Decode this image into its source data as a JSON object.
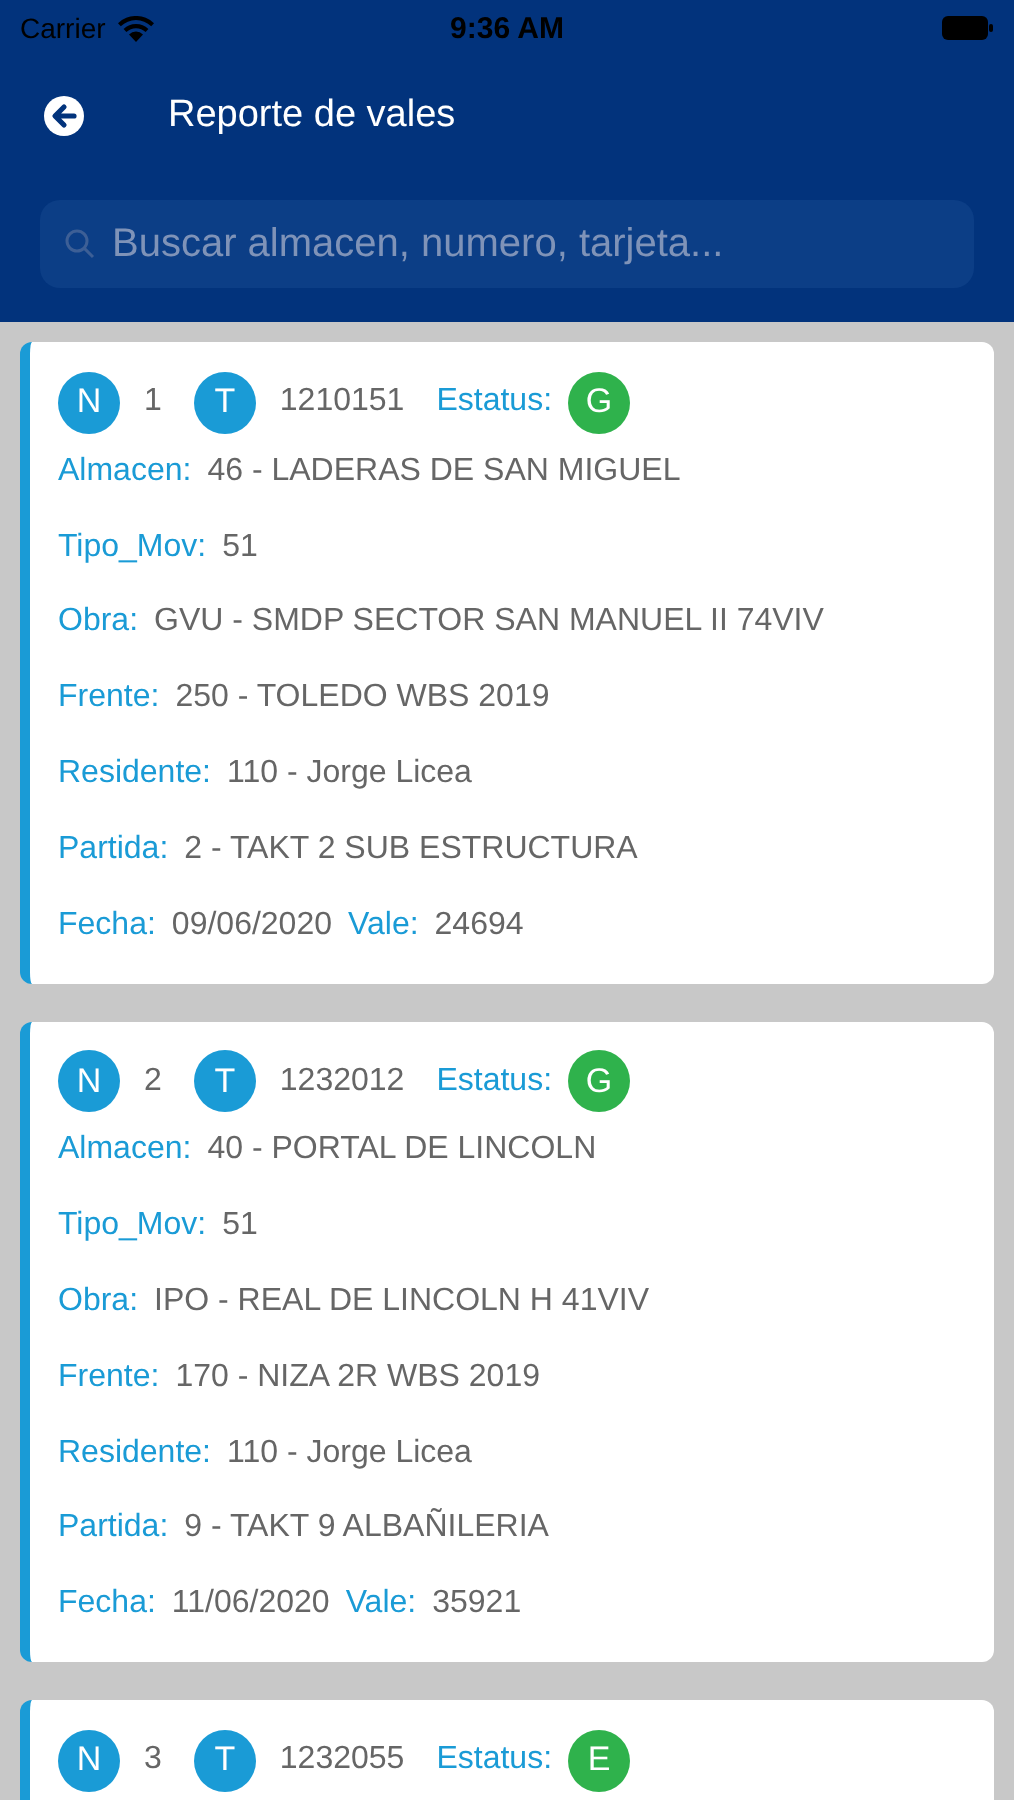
{
  "status_bar": {
    "carrier": "Carrier",
    "time": "9:36 AM"
  },
  "header": {
    "title": "Reporte de vales"
  },
  "search": {
    "placeholder": "Buscar almacen, numero, tarjeta..."
  },
  "cards": [
    {
      "n_badge": "N",
      "number": "1",
      "t_badge": "T",
      "card": "1210151",
      "status_label": "Estatus:",
      "status": "G",
      "rows": [
        [
          {
            "label": "Almacen:",
            "value": "46 - LADERAS DE SAN MIGUEL"
          }
        ],
        [
          {
            "label": "Tipo_Mov:",
            "value": "51"
          }
        ],
        [
          {
            "label": "Obra:",
            "value": "GVU - SMDP SECTOR SAN MANUEL II 74VIV"
          }
        ],
        [
          {
            "label": "Frente:",
            "value": "250 - TOLEDO WBS 2019"
          }
        ],
        [
          {
            "label": "Residente:",
            "value": "110 - Jorge Licea"
          }
        ],
        [
          {
            "label": "Partida:",
            "value": "2 - TAKT 2 SUB ESTRUCTURA"
          }
        ],
        [
          {
            "label": "Fecha:",
            "value": "09/06/2020"
          },
          {
            "label": "Vale:",
            "value": "24694"
          }
        ]
      ]
    },
    {
      "n_badge": "N",
      "number": "2",
      "t_badge": "T",
      "card": "1232012",
      "status_label": "Estatus:",
      "status": "G",
      "rows": [
        [
          {
            "label": "Almacen:",
            "value": "40 - PORTAL DE LINCOLN"
          }
        ],
        [
          {
            "label": "Tipo_Mov:",
            "value": "51"
          }
        ],
        [
          {
            "label": "Obra:",
            "value": "IPO - REAL DE LINCOLN H 41VIV"
          }
        ],
        [
          {
            "label": "Frente:",
            "value": "170 - NIZA 2R WBS 2019"
          }
        ],
        [
          {
            "label": "Residente:",
            "value": "110 - Jorge Licea"
          }
        ],
        [
          {
            "label": "Partida:",
            "value": "9 - TAKT 9 ALBAÑILERIA"
          }
        ],
        [
          {
            "label": "Fecha:",
            "value": "11/06/2020"
          },
          {
            "label": "Vale:",
            "value": "35921"
          }
        ]
      ]
    },
    {
      "n_badge": "N",
      "number": "3",
      "t_badge": "T",
      "card": "1232055",
      "status_label": "Estatus:",
      "status": "E"
    }
  ]
}
